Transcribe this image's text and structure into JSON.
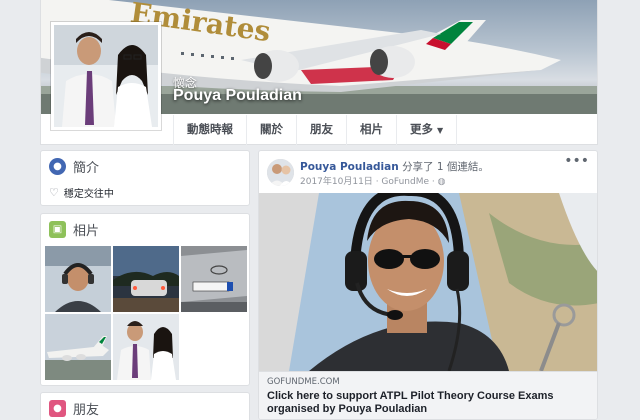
{
  "profile": {
    "memorial_label": "懷念",
    "name": "Pouya Pouladian",
    "cover_brand_text": "Emirates"
  },
  "nav": {
    "tabs": [
      {
        "label": "動態時報"
      },
      {
        "label": "關於"
      },
      {
        "label": "朋友"
      },
      {
        "label": "相片"
      },
      {
        "label": "更多"
      }
    ]
  },
  "intro": {
    "title": "簡介",
    "relationship": "穩定交往中"
  },
  "photos": {
    "title": "相片"
  },
  "friends": {
    "title": "朋友"
  },
  "post": {
    "author": "Pouya Pouladian",
    "action": "分享了 1 個連結。",
    "date": "2017年10月11日",
    "via": "GoFundMe",
    "link_domain": "GOFUNDME.COM",
    "link_title_line1": "Click here to support ATPL Pilot Theory Course Exams",
    "link_title_line2": "organised by Pouya Pouladian"
  },
  "colors": {
    "link_blue": "#365899",
    "intro_icon": "#4267b2",
    "photos_icon": "#8ec15a",
    "friends_icon": "#e05680"
  },
  "icons": {
    "intro": "globe-icon",
    "relationship": "heart-icon",
    "photos": "picture-icon",
    "friends": "friends-icon",
    "privacy": "globe-icon",
    "more": "ellipsis-icon"
  }
}
